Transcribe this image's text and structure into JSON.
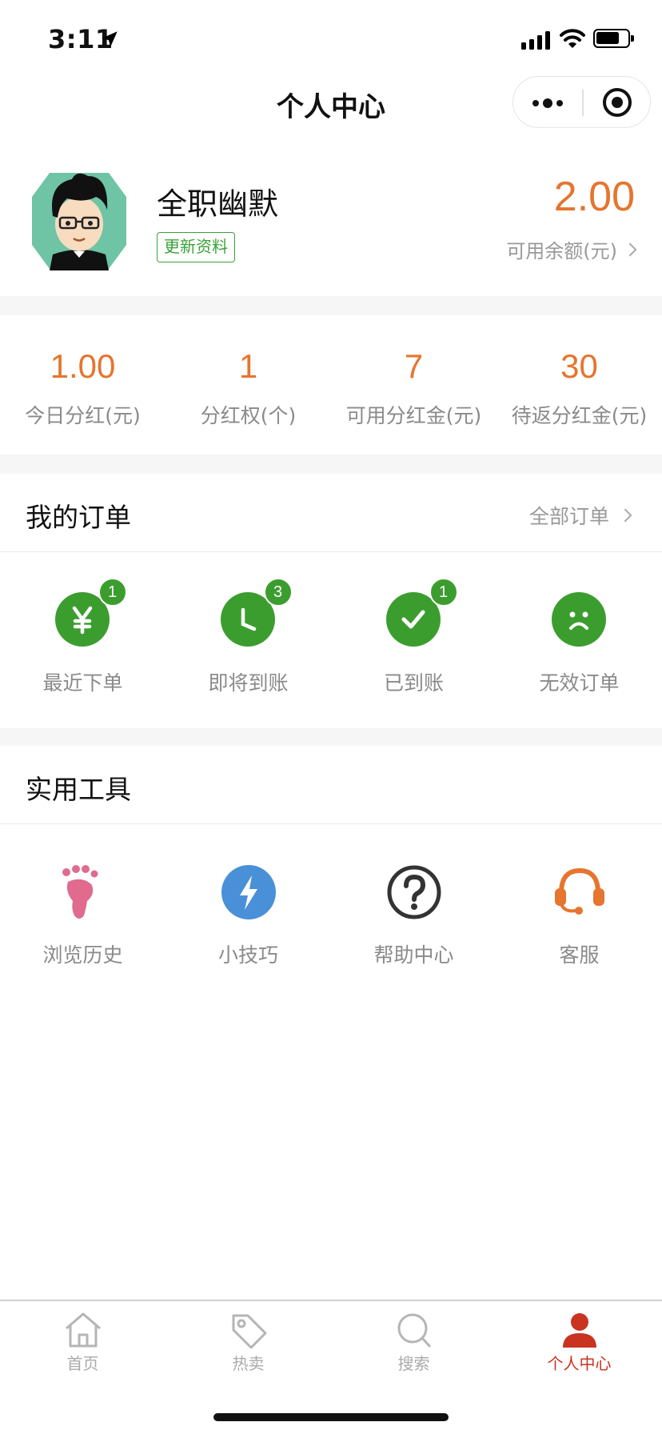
{
  "status_bar": {
    "time": "3:11"
  },
  "nav": {
    "title": "个人中心"
  },
  "profile": {
    "username": "全职幽默",
    "update_label": "更新资料",
    "balance_value": "2.00",
    "balance_label": "可用余额(元)"
  },
  "stats": [
    {
      "value": "1.00",
      "label": "今日分红(元)"
    },
    {
      "value": "1",
      "label": "分红权(个)"
    },
    {
      "value": "7",
      "label": "可用分红金(元)"
    },
    {
      "value": "30",
      "label": "待返分红金(元)"
    }
  ],
  "orders": {
    "title": "我的订单",
    "all_label": "全部订单",
    "items": [
      {
        "label": "最近下单",
        "badge": "1",
        "icon": "yen-icon"
      },
      {
        "label": "即将到账",
        "badge": "3",
        "icon": "clock-icon"
      },
      {
        "label": "已到账",
        "badge": "1",
        "icon": "check-icon"
      },
      {
        "label": "无效订单",
        "badge": "",
        "icon": "sad-face-icon"
      }
    ]
  },
  "tools": {
    "title": "实用工具",
    "items": [
      {
        "label": "浏览历史",
        "icon": "footprint-icon"
      },
      {
        "label": "小技巧",
        "icon": "lightning-icon"
      },
      {
        "label": "帮助中心",
        "icon": "question-icon"
      },
      {
        "label": "客服",
        "icon": "headset-icon"
      }
    ]
  },
  "tabbar": {
    "items": [
      {
        "label": "首页",
        "icon": "home-icon"
      },
      {
        "label": "热卖",
        "icon": "tag-icon"
      },
      {
        "label": "搜索",
        "icon": "search-icon"
      },
      {
        "label": "个人中心",
        "icon": "person-icon"
      }
    ],
    "active_index": 3
  },
  "colors": {
    "accent_orange": "#e5752f",
    "green": "#3c9d2f",
    "active_red": "#c8341f",
    "muted_text": "#8a8a8a"
  }
}
